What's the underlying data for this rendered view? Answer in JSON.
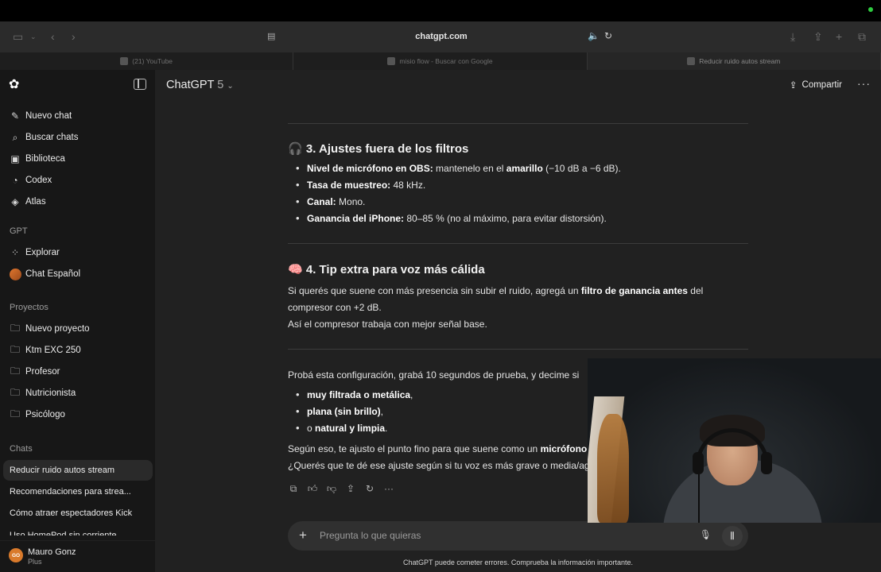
{
  "browser": {
    "url": "chatgpt.com",
    "tabs": [
      {
        "label": "(21) YouTube",
        "active": false
      },
      {
        "label": "misio flow - Buscar con Google",
        "active": false
      },
      {
        "label": "Reducir ruido autos stream",
        "active": true
      }
    ]
  },
  "sidebar": {
    "top_items": [
      {
        "label": "Nuevo chat",
        "icon": "edit-icon"
      },
      {
        "label": "Buscar chats",
        "icon": "search-icon"
      },
      {
        "label": "Biblioteca",
        "icon": "library-icon"
      },
      {
        "label": "Codex",
        "icon": "codex-icon"
      },
      {
        "label": "Atlas",
        "icon": "compass-icon"
      }
    ],
    "gpt_heading": "GPT",
    "gpt_items": [
      {
        "label": "Explorar",
        "icon": "grid-icon"
      },
      {
        "label": "Chat Español",
        "icon": "avatar"
      }
    ],
    "projects_heading": "Proyectos",
    "project_items": [
      {
        "label": "Nuevo proyecto",
        "icon": "new-folder-icon"
      },
      {
        "label": "Ktm EXC 250",
        "icon": "folder-icon"
      },
      {
        "label": "Profesor",
        "icon": "folder-icon"
      },
      {
        "label": "Nutricionista",
        "icon": "folder-icon"
      },
      {
        "label": "Psicólogo",
        "icon": "folder-icon"
      }
    ],
    "chats_heading": "Chats",
    "chat_items": [
      {
        "label": "Reducir ruido autos stream",
        "active": true
      },
      {
        "label": "Recomendaciones para strea...",
        "active": false
      },
      {
        "label": "Cómo atraer espectadores Kick",
        "active": false
      },
      {
        "label": "Uso HomePod sin corriente",
        "active": false
      }
    ],
    "user": {
      "initials": "GO",
      "name": "Mauro Gonz",
      "plan": "Plus"
    }
  },
  "header": {
    "model_name": "ChatGPT",
    "model_version": "5",
    "share_label": "Compartir"
  },
  "message": {
    "section3": {
      "icon": "🎧",
      "title": "3. Ajustes fuera de los filtros",
      "bullets": [
        {
          "bold": "Nivel de micrófono en OBS:",
          "pre": " mantenelo en el ",
          "bold2": "amarillo",
          "post": " (−10 dB a −6 dB)."
        },
        {
          "bold": "Tasa de muestreo:",
          "post": " 48 kHz."
        },
        {
          "bold": "Canal:",
          "post": " Mono."
        },
        {
          "bold": "Ganancia del iPhone:",
          "post": " 80–85 % (no al máximo, para evitar distorsión)."
        }
      ]
    },
    "section4": {
      "icon": "🧠",
      "title": "4. Tip extra para voz más cálida",
      "p1_pre": "Si querés que suene con más presencia sin subir el ruido, agregá un ",
      "p1_bold": "filtro de ganancia antes",
      "p1_post": " del",
      "p1_line2": "compresor con +2 dB.",
      "p2": "Así el compresor trabaja con mejor señal base."
    },
    "closing": {
      "intro": "Probá esta configuración, grabá 10 segundos de prueba, y decime si",
      "bullets": [
        {
          "pre": "",
          "bold": "muy filtrada o metálica",
          "post": ","
        },
        {
          "pre": "",
          "bold": "plana (sin brillo)",
          "post": ","
        },
        {
          "pre": "o ",
          "bold": "natural y limpia",
          "post": "."
        }
      ],
      "line1_pre": "Según eso, te ajusto el punto fino para que suene como un ",
      "line1_bold": "micrófono",
      "line2": "¿Querés que te dé ese ajuste según si tu voz es más grave o media/ag"
    }
  },
  "composer": {
    "placeholder": "Pregunta lo que quieras",
    "disclaimer": "ChatGPT puede cometer errores. Comprueba la información importante."
  }
}
